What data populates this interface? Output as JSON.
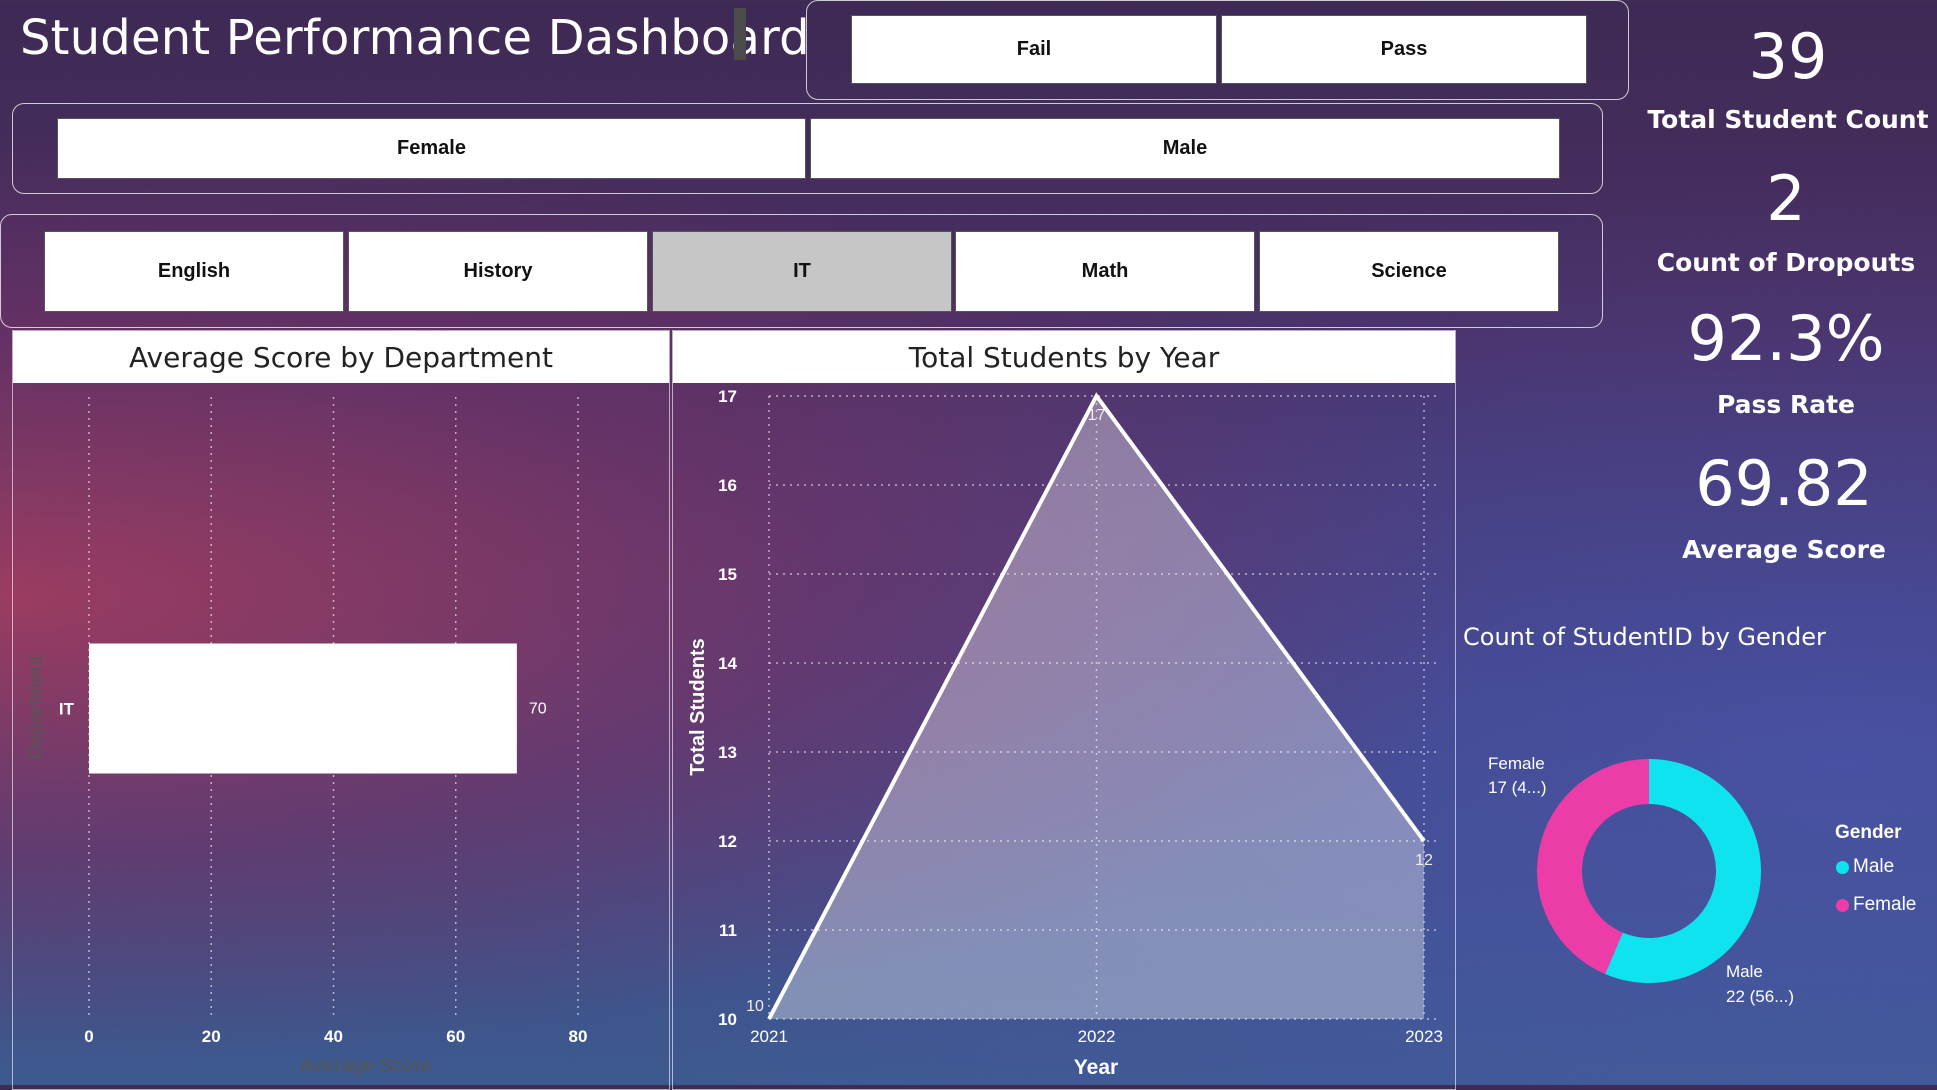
{
  "header": {
    "title": "Student Performance Dashboard"
  },
  "slicers": {
    "result": [
      "Fail",
      "Pass"
    ],
    "gender": [
      "Female",
      "Male"
    ],
    "department": [
      "English",
      "History",
      "IT",
      "Math",
      "Science"
    ],
    "department_selected": "IT"
  },
  "kpis": [
    {
      "value": "39",
      "label": "Total Student Count"
    },
    {
      "value": "2",
      "label": "Count of Dropouts"
    },
    {
      "value": "92.3%",
      "label": "Pass Rate"
    },
    {
      "value": "69.82",
      "label": "Average Score"
    }
  ],
  "colors": {
    "male": "#0fe3ef",
    "female": "#ec3ca8",
    "bar": "#ffffff",
    "line": "#ffffff"
  },
  "chart_data": [
    {
      "type": "bar",
      "title": "Average Score by Department",
      "orientation": "horizontal",
      "categories": [
        "IT"
      ],
      "values": [
        70
      ],
      "data_labels": [
        "70"
      ],
      "xlabel": "Average Score",
      "ylabel": "Department",
      "xlim": [
        0,
        80
      ],
      "xticks": [
        "0",
        "20",
        "40",
        "60",
        "80"
      ],
      "grid": true
    },
    {
      "type": "area",
      "title": "Total Students by Year",
      "x": [
        "2021",
        "2022",
        "2023"
      ],
      "values": [
        10,
        17,
        12
      ],
      "data_labels": [
        "10",
        "17",
        "12"
      ],
      "xlabel": "Year",
      "ylabel": "Total Students",
      "ylim": [
        10,
        17
      ],
      "yticks": [
        "10",
        "11",
        "12",
        "13",
        "14",
        "15",
        "16",
        "17"
      ],
      "grid": true
    },
    {
      "type": "pie",
      "title": "Count of StudentID by Gender",
      "legend_title": "Gender",
      "legend_placement": "right",
      "categories": [
        "Male",
        "Female"
      ],
      "values": [
        22,
        17
      ],
      "data_labels": [
        {
          "name": "Male",
          "text": "22 (56...)"
        },
        {
          "name": "Female",
          "text": "17 (4...)"
        }
      ]
    }
  ]
}
